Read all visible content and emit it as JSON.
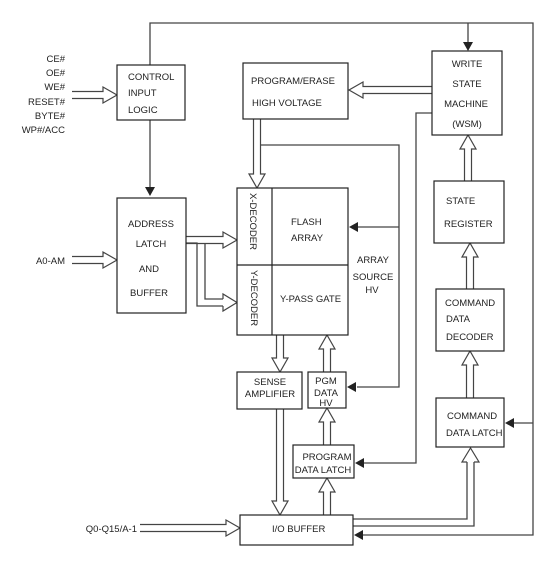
{
  "inputs": {
    "control_signals": [
      "CE#",
      "OE#",
      "WE#",
      "RESET#",
      "BYTE#",
      "WP#/ACC"
    ],
    "address": "A0-AM",
    "data_io": "Q0-Q15/A-1"
  },
  "blocks": {
    "control_input_logic": [
      "CONTROL",
      "INPUT",
      "LOGIC"
    ],
    "address_latch": [
      "ADDRESS",
      "LATCH",
      "AND",
      "BUFFER"
    ],
    "program_erase_hv": [
      "PROGRAM/ERASE",
      "HIGH VOLTAGE"
    ],
    "wsm": [
      "WRITE",
      "STATE",
      "MACHINE",
      "(WSM)"
    ],
    "x_decoder": "X-DECODER",
    "y_decoder": "Y-DECODER",
    "flash_array": [
      "FLASH",
      "ARRAY"
    ],
    "y_pass_gate": "Y-PASS GATE",
    "array_source_hv": [
      "ARRAY",
      "SOURCE",
      "HV"
    ],
    "state_register": [
      "STATE",
      "REGISTER"
    ],
    "command_data_decoder": [
      "COMMAND",
      "DATA",
      "DECODER"
    ],
    "command_data_latch": [
      "COMMAND",
      "DATA LATCH"
    ],
    "sense_amplifier": [
      "SENSE",
      "AMPLIFIER"
    ],
    "pgm_data_hv": [
      "PGM",
      "DATA",
      "HV"
    ],
    "program_data_latch": [
      "PROGRAM",
      "DATA LATCH"
    ],
    "io_buffer": "I/O BUFFER"
  }
}
